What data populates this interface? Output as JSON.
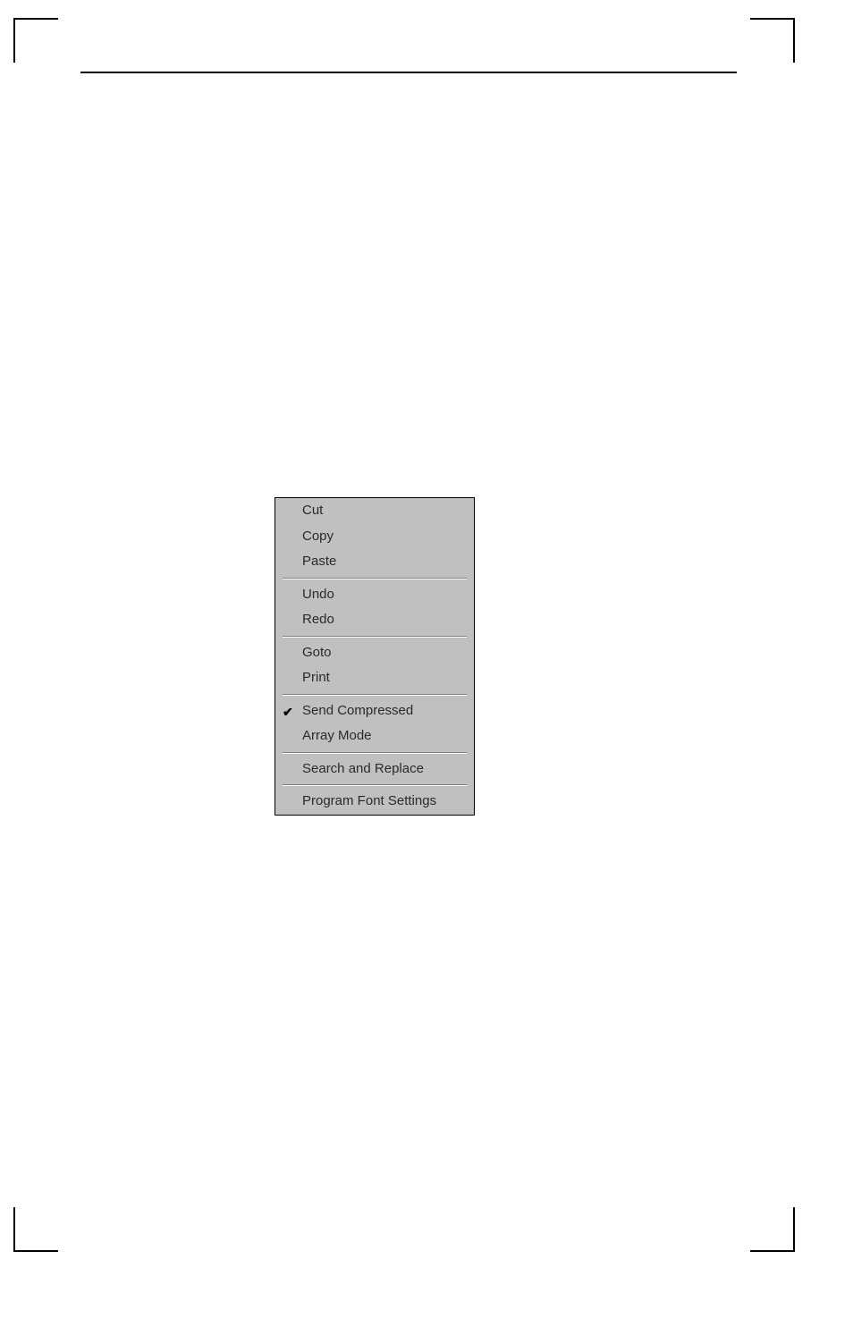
{
  "menu": {
    "items": [
      {
        "label": "Cut",
        "checked": false
      },
      {
        "label": "Copy",
        "checked": false
      },
      {
        "label": "Paste",
        "checked": false
      },
      {
        "separator": true
      },
      {
        "label": "Undo",
        "checked": false
      },
      {
        "label": "Redo",
        "checked": false
      },
      {
        "separator": true
      },
      {
        "label": "Goto",
        "checked": false
      },
      {
        "label": "Print",
        "checked": false
      },
      {
        "separator": true
      },
      {
        "label": "Send Compressed",
        "checked": true
      },
      {
        "label": "Array Mode",
        "checked": false
      },
      {
        "separator": true
      },
      {
        "label": "Search and Replace",
        "checked": false
      },
      {
        "separator": true
      },
      {
        "label": "Program Font Settings",
        "checked": false
      }
    ]
  }
}
